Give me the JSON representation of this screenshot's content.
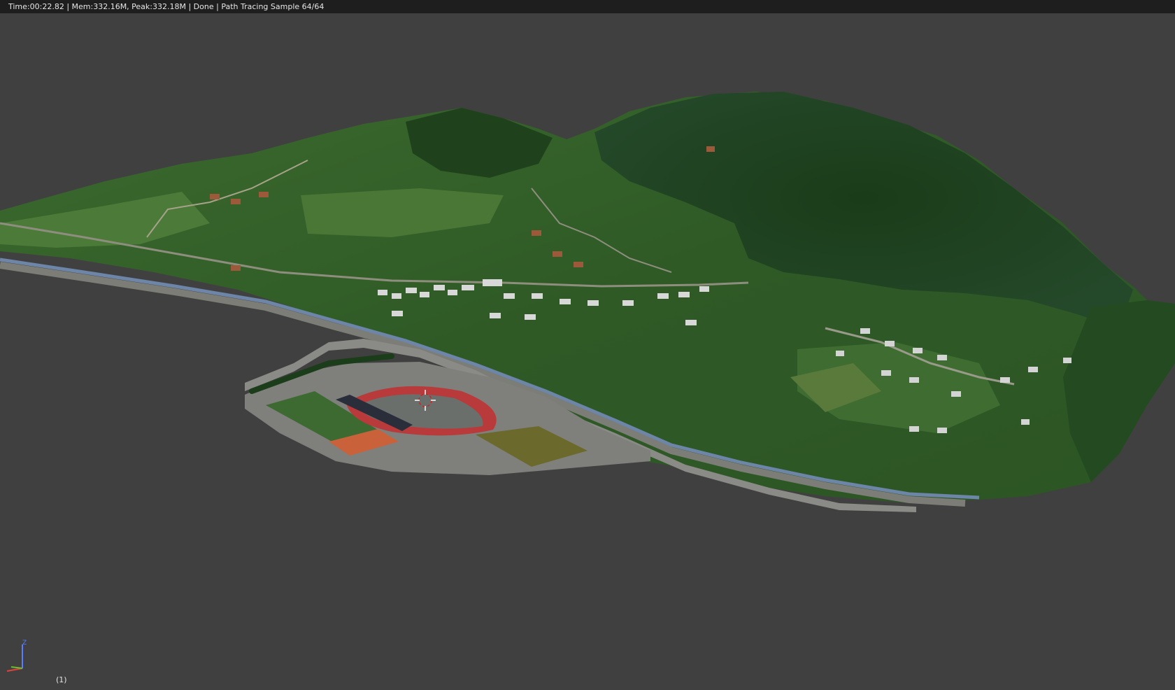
{
  "status_bar": {
    "text": "Time:00:22.82 | Mem:332.16M, Peak:332.18M | Done | Path Tracing Sample 64/64"
  },
  "viewport": {
    "background_color": "#404040",
    "frame_label": "(1)",
    "axis_gizmo": {
      "z_label": "Z",
      "x_color": "#e0433b",
      "y_color": "#6bbd2e",
      "z_color": "#5a7cff"
    },
    "scene": {
      "terrain_color": "#2f5a26",
      "forest_color": "#1f421c",
      "river_color": "#6d85a6",
      "road_color": "#8e8e7e",
      "stadium_track_color": "#b83a3a",
      "tennis_court_color": "#c9623a"
    }
  }
}
